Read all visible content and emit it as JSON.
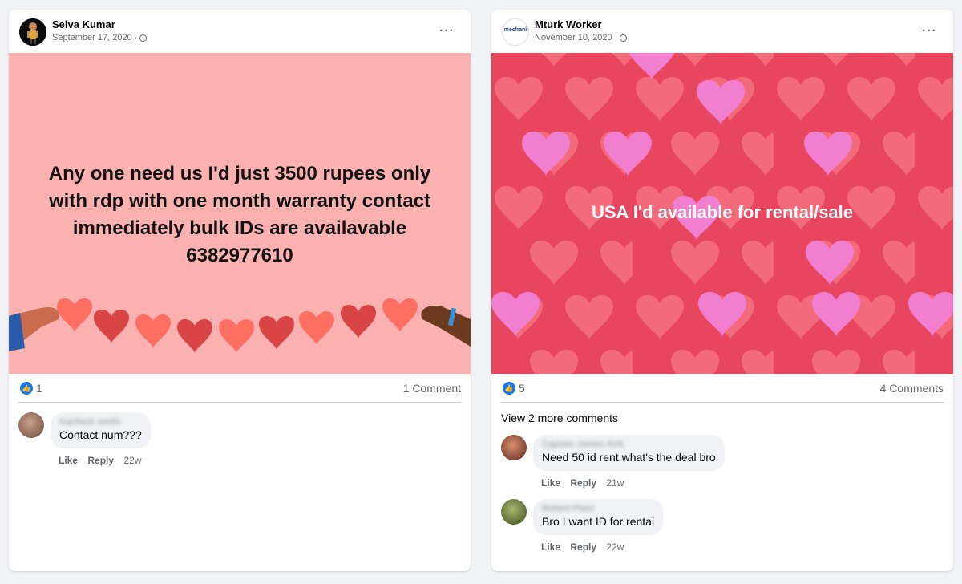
{
  "post1": {
    "author": "Selva Kumar",
    "date": "September 17, 2020 ·",
    "more": "···",
    "media_text": "Any one need us I'd just 3500 rupees only with rdp with one month warranty contact immediately bulk IDs are availavable 6382977610",
    "likes": "1",
    "comments_count": "1 Comment",
    "comments": [
      {
        "name": "Karthick smith",
        "text": "Contact num???",
        "like": "Like",
        "reply": "Reply",
        "time": "22w"
      }
    ]
  },
  "post2": {
    "author": "Mturk Worker",
    "date": "November 10, 2020 ·",
    "more": "···",
    "avatar_text": "mechani",
    "media_text": "USA I'd available for rental/sale",
    "likes": "5",
    "comments_count": "4 Comments",
    "view_more": "View 2 more comments",
    "comments": [
      {
        "name": "Captain James Kirk",
        "text": "Need 50 id rent what's the deal bro",
        "like": "Like",
        "reply": "Reply",
        "time": "21w"
      },
      {
        "name": "Robert Plant",
        "text": "Bro I want ID for rental",
        "like": "Like",
        "reply": "Reply",
        "time": "22w"
      }
    ]
  },
  "icons": {
    "like": "thumbs-up-icon",
    "privacy": "globe-icon",
    "menu": "more-icon"
  },
  "colors": {
    "accent": "#1877f2",
    "bg": "#f0f2f5",
    "post1_bg": "#fbb1b0",
    "post2_bg": "#e8455f"
  }
}
